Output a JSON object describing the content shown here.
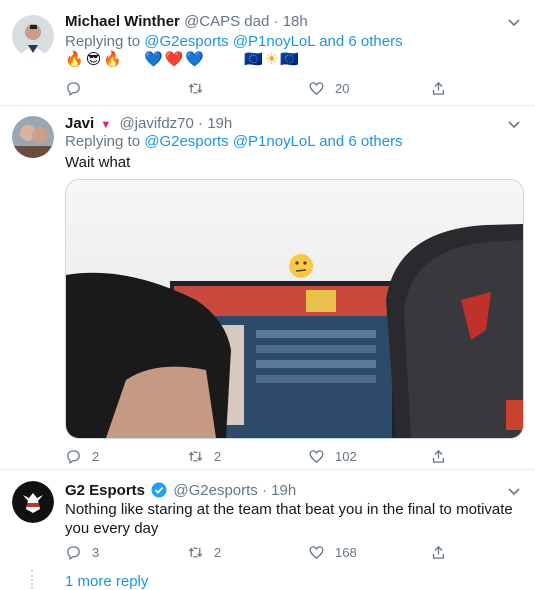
{
  "tweets": [
    {
      "name": "Michael Winther",
      "handle": "@CAPS dad",
      "dot": "·",
      "time": "18h",
      "replying_prefix": "Replying to",
      "replying_to": "@G2esports @P1noyLoL",
      "replying_suffix": "and 6 others",
      "emojis": [
        "🔥",
        "😎",
        "🔥",
        "💙",
        "❤️",
        "💙",
        "🇪🇺",
        "☀",
        "🇪🇺"
      ],
      "reply_count": "",
      "retweet_count": "",
      "like_count": "20"
    },
    {
      "name": "Javi",
      "badge": "▼",
      "handle": "@javifdz70",
      "dot": "·",
      "time": "19h",
      "replying_prefix": "Replying to",
      "replying_to": "@G2esports @P1noyLoL",
      "replying_suffix": "and 6 others",
      "text": "Wait what",
      "reply_count": "2",
      "retweet_count": "2",
      "like_count": "102"
    },
    {
      "name": "G2 Esports",
      "handle": "@G2esports",
      "dot": "·",
      "time": "19h",
      "text": "Nothing like staring at the team that beat you in the final to motivate you every day",
      "reply_count": "3",
      "retweet_count": "2",
      "like_count": "168"
    }
  ],
  "more_reply": "1 more reply",
  "colors": {
    "link": "#1b95e0",
    "muted": "#657786",
    "border": "#e6ecf0",
    "verified": "#1da1f2",
    "badge": "#e0245e"
  }
}
